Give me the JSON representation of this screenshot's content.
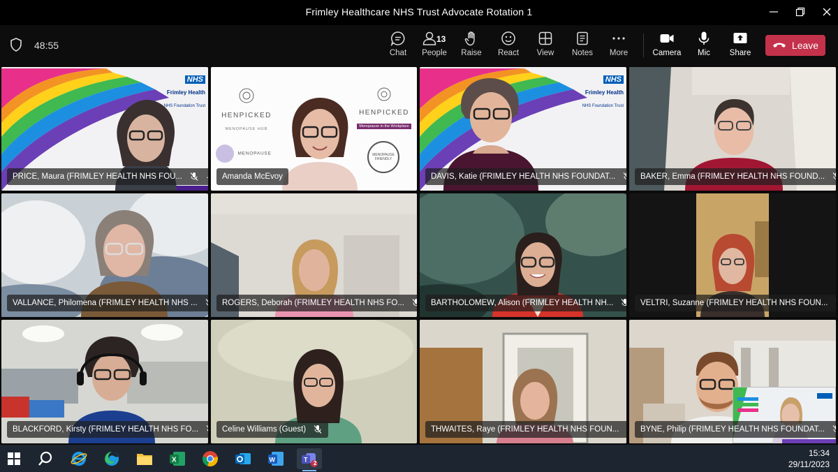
{
  "window": {
    "title": "Frimley Healthcare NHS Trust Advocate Rotation 1"
  },
  "meeting": {
    "timer": "48:55",
    "buttons": {
      "chat": "Chat",
      "people": "People",
      "people_count": "13",
      "raise": "Raise",
      "react": "React",
      "view": "View",
      "notes": "Notes",
      "more": "More",
      "camera": "Camera",
      "mic": "Mic",
      "share": "Share",
      "leave": "Leave"
    }
  },
  "participants": [
    {
      "name": "PRICE, Maura (FRIMLEY HEALTH NHS FOU...",
      "muted": true,
      "more_menu": "···"
    },
    {
      "name": "Amanda McEvoy",
      "muted": false
    },
    {
      "name": "DAVIS, Katie (FRIMLEY HEALTH NHS FOUNDAT...",
      "muted": true
    },
    {
      "name": "BAKER, Emma (FRIMLEY HEALTH NHS FOUND...",
      "muted": true
    },
    {
      "name": "VALLANCE, Philomena (FRIMLEY HEALTH NHS ...",
      "muted": true
    },
    {
      "name": "ROGERS, Deborah (FRIMLEY HEALTH NHS FO...",
      "muted": true
    },
    {
      "name": "BARTHOLOMEW, Alison (FRIMLEY HEALTH NH...",
      "muted": true
    },
    {
      "name": "VELTRI, Suzanne (FRIMLEY HEALTH NHS FOUN...",
      "muted": true
    },
    {
      "name": "BLACKFORD, Kirsty (FRIMLEY HEALTH NHS FO...",
      "muted": true
    },
    {
      "name": "Celine Williams (Guest)",
      "muted": true
    },
    {
      "name": "THWAITES, Raye (FRIMLEY HEALTH NHS FOUN...",
      "muted": true
    },
    {
      "name": "BYNE, Philip (FRIMLEY HEALTH NHS FOUNDAT...",
      "muted": true
    }
  ],
  "backgrounds": {
    "nhs_logo": "NHS",
    "trust_name": "Frimley Health",
    "trust_sub": "NHS Foundation Trust",
    "henpicked": "HENPICKED",
    "menopause_hub": "MENOPAUSE HUB",
    "menopause_workplace": "Menopause in the Workplace",
    "menopause": "MENOPAUSE",
    "menopause_friendly": "MENOPAUSE FRIENDLY"
  },
  "taskbar": {
    "time": "15:34",
    "date": "29/11/2023",
    "teams_badge": "2",
    "icons": [
      "windows-start-icon",
      "search-icon",
      "internet-explorer-icon",
      "edge-icon",
      "file-explorer-icon",
      "excel-icon",
      "chrome-icon",
      "outlook-icon",
      "word-icon",
      "teams-icon"
    ]
  },
  "colors": {
    "leave": "#c4314b",
    "taskbar": "#1d2630",
    "toolbar": "#0d0d0d"
  }
}
